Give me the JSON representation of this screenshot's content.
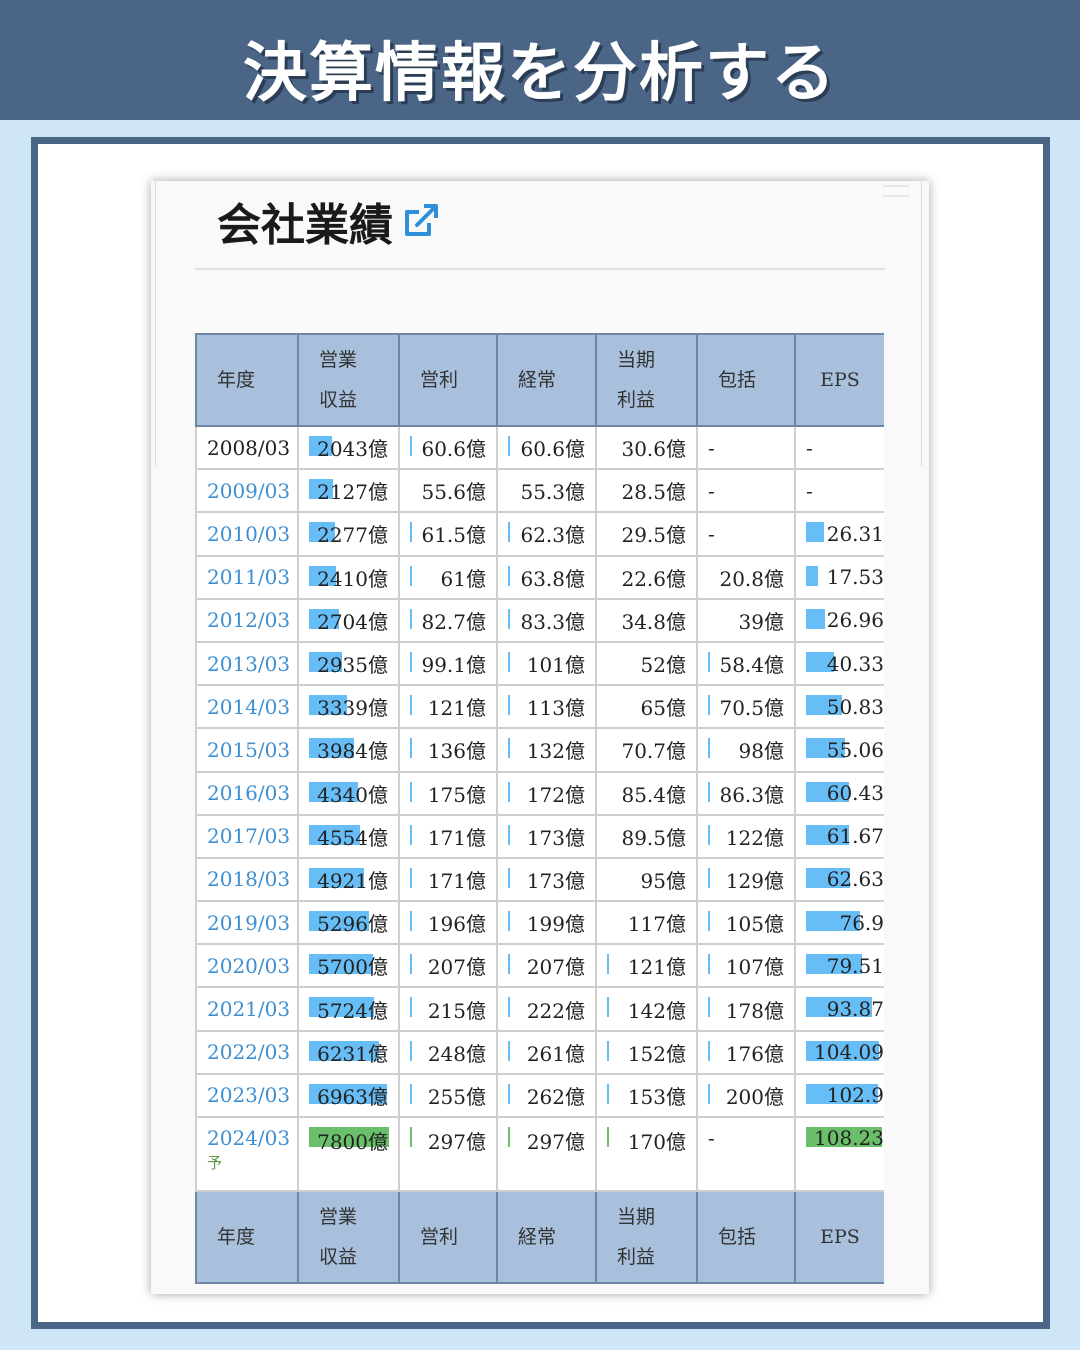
{
  "banner": {
    "title": "決算情報を分析する"
  },
  "card": {
    "title": "会社業績",
    "icon": "external-link-icon"
  },
  "colors": {
    "banner": "#4a6586",
    "header_bg": "#a9c0dc",
    "bar_blue": "#67bdf6",
    "bar_green": "#6ac06a",
    "year_link": "#3d8fd1"
  },
  "table": {
    "headers": [
      {
        "line1": "年度",
        "line2": ""
      },
      {
        "line1": "営業",
        "line2": "収益"
      },
      {
        "line1": "営利",
        "line2": ""
      },
      {
        "line1": "経常",
        "line2": ""
      },
      {
        "line1": "当期",
        "line2": "利益"
      },
      {
        "line1": "包括",
        "line2": ""
      },
      {
        "line1": "EPS",
        "line2": ""
      }
    ],
    "rows": [
      {
        "year": "2008/03",
        "sub": "",
        "revenue": "2043億",
        "revenue_bar": 0.29,
        "op": "60.6億",
        "op_bar": 0.004,
        "ord": "60.6億",
        "ord_bar": 0.004,
        "net": "30.6億",
        "net_bar": 0,
        "comp": "-",
        "comp_bar": 0,
        "eps": "-",
        "eps_bar": 0
      },
      {
        "year": "2009/03",
        "sub": "",
        "revenue": "2127億",
        "revenue_bar": 0.3,
        "op": "55.6億",
        "op_bar": 0,
        "ord": "55.3億",
        "ord_bar": 0,
        "net": "28.5億",
        "net_bar": 0,
        "comp": "-",
        "comp_bar": 0,
        "eps": "-",
        "eps_bar": 0
      },
      {
        "year": "2010/03",
        "sub": "",
        "revenue": "2277億",
        "revenue_bar": 0.32,
        "op": "61.5億",
        "op_bar": 0.004,
        "ord": "62.3億",
        "ord_bar": 0.004,
        "net": "29.5億",
        "net_bar": 0,
        "comp": "-",
        "comp_bar": 0,
        "eps": "26.31",
        "eps_bar": 0.24
      },
      {
        "year": "2011/03",
        "sub": "",
        "revenue": "2410億",
        "revenue_bar": 0.34,
        "op": "61億",
        "op_bar": 0.004,
        "ord": "63.8億",
        "ord_bar": 0.004,
        "net": "22.6億",
        "net_bar": 0,
        "comp": "20.8億",
        "comp_bar": 0,
        "eps": "17.53",
        "eps_bar": 0.16
      },
      {
        "year": "2012/03",
        "sub": "",
        "revenue": "2704億",
        "revenue_bar": 0.38,
        "op": "82.7億",
        "op_bar": 0.004,
        "ord": "83.3億",
        "ord_bar": 0.004,
        "net": "34.8億",
        "net_bar": 0,
        "comp": "39億",
        "comp_bar": 0,
        "eps": "26.96",
        "eps_bar": 0.25
      },
      {
        "year": "2013/03",
        "sub": "",
        "revenue": "2935億",
        "revenue_bar": 0.41,
        "op": "99.1億",
        "op_bar": 0.004,
        "ord": "101億",
        "ord_bar": 0.004,
        "net": "52億",
        "net_bar": 0,
        "comp": "58.4億",
        "comp_bar": 0.01,
        "eps": "40.33",
        "eps_bar": 0.37
      },
      {
        "year": "2014/03",
        "sub": "",
        "revenue": "3339億",
        "revenue_bar": 0.47,
        "op": "121億",
        "op_bar": 0.01,
        "ord": "113億",
        "ord_bar": 0.01,
        "net": "65億",
        "net_bar": 0,
        "comp": "70.5億",
        "comp_bar": 0.01,
        "eps": "50.83",
        "eps_bar": 0.47
      },
      {
        "year": "2015/03",
        "sub": "",
        "revenue": "3984億",
        "revenue_bar": 0.56,
        "op": "136億",
        "op_bar": 0.01,
        "ord": "132億",
        "ord_bar": 0.01,
        "net": "70.7億",
        "net_bar": 0,
        "comp": "98億",
        "comp_bar": 0.01,
        "eps": "55.06",
        "eps_bar": 0.51
      },
      {
        "year": "2016/03",
        "sub": "",
        "revenue": "4340億",
        "revenue_bar": 0.61,
        "op": "175億",
        "op_bar": 0.01,
        "ord": "172億",
        "ord_bar": 0.01,
        "net": "85.4億",
        "net_bar": 0,
        "comp": "86.3億",
        "comp_bar": 0.01,
        "eps": "60.43",
        "eps_bar": 0.56
      },
      {
        "year": "2017/03",
        "sub": "",
        "revenue": "4554億",
        "revenue_bar": 0.64,
        "op": "171億",
        "op_bar": 0.01,
        "ord": "173億",
        "ord_bar": 0.01,
        "net": "89.5億",
        "net_bar": 0,
        "comp": "122億",
        "comp_bar": 0.01,
        "eps": "61.67",
        "eps_bar": 0.57
      },
      {
        "year": "2018/03",
        "sub": "",
        "revenue": "4921億",
        "revenue_bar": 0.69,
        "op": "171億",
        "op_bar": 0.01,
        "ord": "173億",
        "ord_bar": 0.01,
        "net": "95億",
        "net_bar": 0,
        "comp": "129億",
        "comp_bar": 0.01,
        "eps": "62.63",
        "eps_bar": 0.58
      },
      {
        "year": "2019/03",
        "sub": "",
        "revenue": "5296億",
        "revenue_bar": 0.75,
        "op": "196億",
        "op_bar": 0.01,
        "ord": "199億",
        "ord_bar": 0.01,
        "net": "117億",
        "net_bar": 0,
        "comp": "105億",
        "comp_bar": 0.01,
        "eps": "76.9",
        "eps_bar": 0.71
      },
      {
        "year": "2020/03",
        "sub": "",
        "revenue": "5700億",
        "revenue_bar": 0.8,
        "op": "207億",
        "op_bar": 0.01,
        "ord": "207億",
        "ord_bar": 0.01,
        "net": "121億",
        "net_bar": 0.01,
        "comp": "107億",
        "comp_bar": 0.01,
        "eps": "79.51",
        "eps_bar": 0.74
      },
      {
        "year": "2021/03",
        "sub": "",
        "revenue": "5724億",
        "revenue_bar": 0.81,
        "op": "215億",
        "op_bar": 0.01,
        "ord": "222億",
        "ord_bar": 0.01,
        "net": "142億",
        "net_bar": 0.01,
        "comp": "178億",
        "comp_bar": 0.01,
        "eps": "93.87",
        "eps_bar": 0.87
      },
      {
        "year": "2022/03",
        "sub": "",
        "revenue": "6231億",
        "revenue_bar": 0.88,
        "op": "248億",
        "op_bar": 0.01,
        "ord": "261億",
        "ord_bar": 0.01,
        "net": "152億",
        "net_bar": 0.01,
        "comp": "176億",
        "comp_bar": 0.01,
        "eps": "104.09",
        "eps_bar": 0.96
      },
      {
        "year": "2023/03",
        "sub": "",
        "revenue": "6963億",
        "revenue_bar": 0.98,
        "op": "255億",
        "op_bar": 0.01,
        "ord": "262億",
        "ord_bar": 0.01,
        "net": "153億",
        "net_bar": 0.01,
        "comp": "200億",
        "comp_bar": 0.01,
        "eps": "102.9",
        "eps_bar": 0.95
      },
      {
        "year": "2024/03",
        "sub": "予",
        "revenue": "7800億",
        "revenue_bar": 1.0,
        "op": "297億",
        "op_bar": 0.01,
        "ord": "297億",
        "ord_bar": 0.01,
        "net": "170億",
        "net_bar": 0.01,
        "comp": "-",
        "comp_bar": 0,
        "eps": "108.23",
        "eps_bar": 1.0,
        "forecast": true
      }
    ]
  }
}
